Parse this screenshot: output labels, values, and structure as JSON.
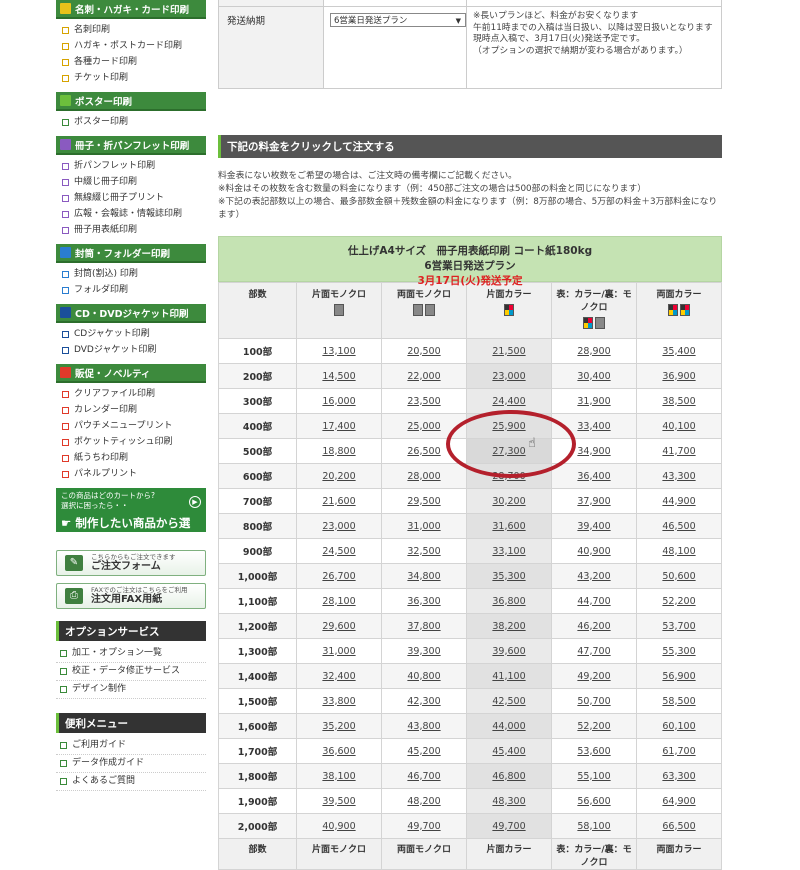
{
  "sidebar": {
    "categories": [
      {
        "title": "名刺・ハガキ・カード印刷",
        "icon_color": "#e8c21a",
        "sq_color": "#d6a300",
        "items": [
          "名刺印刷",
          "ハガキ・ポストカード印刷",
          "各種カード印刷",
          "チケット印刷"
        ]
      },
      {
        "title": "ポスター印刷",
        "icon_color": "#6cbf3c",
        "sq_color": "#3a8a3a",
        "items": [
          "ポスター印刷"
        ]
      },
      {
        "title": "冊子・折パンフレット印刷",
        "icon_color": "#8a5ac0",
        "sq_color": "#8a5ac0",
        "items": [
          "折パンフレット印刷",
          "中綴じ冊子印刷",
          "無線綴じ冊子プリント",
          "広報・会報誌・情報誌印刷",
          "冊子用表紙印刷"
        ]
      },
      {
        "title": "封筒・フォルダー印刷",
        "icon_color": "#2a7dd0",
        "sq_color": "#2a7dd0",
        "items": [
          "封筒(割込) 印刷",
          "フォルダ印刷"
        ]
      },
      {
        "title": "CD・DVDジャケット印刷",
        "icon_color": "#1a4f9a",
        "sq_color": "#1a4f9a",
        "items": [
          "CDジャケット印刷",
          "DVDジャケット印刷"
        ]
      },
      {
        "title": "販促・ノベルティ",
        "icon_color": "#e03a2a",
        "sq_color": "#e03a2a",
        "items": [
          "クリアファイル印刷",
          "カレンダー印刷",
          "パウチメニュープリント",
          "ポケットティッシュ印刷",
          "紙うちわ印刷",
          "パネルプリント"
        ]
      }
    ],
    "select_banner": {
      "line1": "この商品はどのカートから?",
      "line2": "選択に困ったら・・",
      "main": "制作したい商品から選ぶ"
    },
    "order_form": {
      "small": "こちらからもご注文できます",
      "label": "ご注文フォーム"
    },
    "fax_form": {
      "small": "FAXでのご注文はこちらをご利用",
      "label": "注文用FAX用紙"
    },
    "option_service": {
      "title": "オプションサービス",
      "items": [
        "加工・オプション一覧",
        "校正・データ修正サービス",
        "デザイン制作"
      ]
    },
    "convenience": {
      "title": "便利メニュー",
      "items": [
        "ご利用ガイド",
        "データ作成ガイド",
        "よくあるご質問"
      ]
    }
  },
  "delivery": {
    "label": "発送納期",
    "selected": "6営業日発送プラン",
    "notes": [
      "※長いプランほど、料金がお安くなります",
      "午前11時までの入稿は当日扱い、以降は翌日扱いとなります",
      "現時点入稿で、3月17日(火)発送予定です。",
      "（オプションの選択で納期が変わる場合があります。）"
    ]
  },
  "section_title": "下記の料金をクリックして注文する",
  "notes": [
    "料金表にない枚数をご希望の場合は、ご注文時の備考欄にご記載ください。",
    "※料金はその枚数を含む数量の料金になります（例：450部ご注文の場合は500部の料金と同じになります）",
    "※下記の表記部数以上の場合、最多部数金額＋残数金額の料金になります（例：8万部の場合、5万部の料金＋3万部料金になります）"
  ],
  "price_table": {
    "title": "仕上げA4サイズ　冊子用表紙印刷 コート紙180kg",
    "plan": "6営業日発送プラン",
    "ship": "3月17日(火)発送予定",
    "headers": [
      "部数",
      "片面モノクロ",
      "両面モノクロ",
      "片面カラー",
      "表：カラー/裏：モノクロ",
      "両面カラー"
    ],
    "rows": [
      [
        "100部",
        "13,100",
        "20,500",
        "21,500",
        "28,900",
        "35,400"
      ],
      [
        "200部",
        "14,500",
        "22,000",
        "23,000",
        "30,400",
        "36,900"
      ],
      [
        "300部",
        "16,000",
        "23,500",
        "24,400",
        "31,900",
        "38,500"
      ],
      [
        "400部",
        "17,400",
        "25,000",
        "25,900",
        "33,400",
        "40,100"
      ],
      [
        "500部",
        "18,800",
        "26,500",
        "27,300",
        "34,900",
        "41,700"
      ],
      [
        "600部",
        "20,200",
        "28,000",
        "28,700",
        "36,400",
        "43,300"
      ],
      [
        "700部",
        "21,600",
        "29,500",
        "30,200",
        "37,900",
        "44,900"
      ],
      [
        "800部",
        "23,000",
        "31,000",
        "31,600",
        "39,400",
        "46,500"
      ],
      [
        "900部",
        "24,500",
        "32,500",
        "33,100",
        "40,900",
        "48,100"
      ],
      [
        "1,000部",
        "26,700",
        "34,800",
        "35,300",
        "43,200",
        "50,600"
      ],
      [
        "1,100部",
        "28,100",
        "36,300",
        "36,800",
        "44,700",
        "52,200"
      ],
      [
        "1,200部",
        "29,600",
        "37,800",
        "38,200",
        "46,200",
        "53,700"
      ],
      [
        "1,300部",
        "31,000",
        "39,300",
        "39,600",
        "47,700",
        "55,300"
      ],
      [
        "1,400部",
        "32,400",
        "40,800",
        "41,100",
        "49,200",
        "56,900"
      ],
      [
        "1,500部",
        "33,800",
        "42,300",
        "42,500",
        "50,700",
        "58,500"
      ],
      [
        "1,600部",
        "35,200",
        "43,800",
        "44,000",
        "52,200",
        "60,100"
      ],
      [
        "1,700部",
        "36,600",
        "45,200",
        "45,400",
        "53,600",
        "61,700"
      ],
      [
        "1,800部",
        "38,100",
        "46,700",
        "46,800",
        "55,100",
        "63,300"
      ],
      [
        "1,900部",
        "39,500",
        "48,200",
        "48,300",
        "56,600",
        "64,900"
      ],
      [
        "2,000部",
        "40,900",
        "49,700",
        "49,700",
        "58,100",
        "66,500"
      ]
    ],
    "highlight_row": 4,
    "highlight_col": 3
  },
  "colors": {
    "accent_green": "#3d8a3d",
    "highlight_circle": "#b4202c",
    "ship_red": "#d22"
  }
}
